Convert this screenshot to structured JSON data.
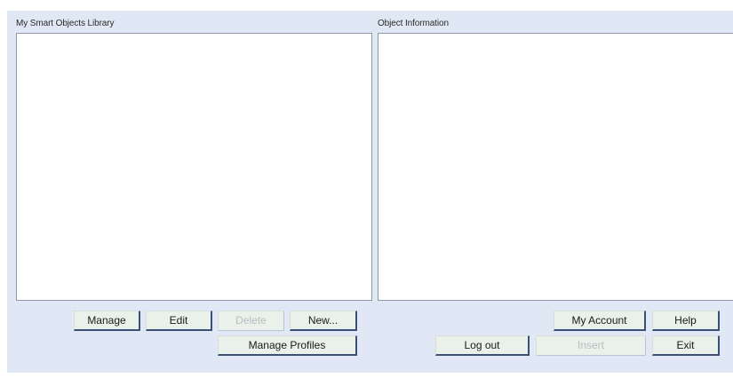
{
  "library_panel": {
    "title": "My Smart Objects Library"
  },
  "info_panel": {
    "title": "Object Information"
  },
  "buttons": {
    "manage": "Manage",
    "edit": "Edit",
    "delete": "Delete",
    "new": "New...",
    "manage_profiles": "Manage Profiles",
    "my_account": "My Account",
    "help": "Help",
    "log_out": "Log out",
    "insert": "Insert",
    "exit": "Exit"
  },
  "button_states": {
    "delete": "disabled",
    "insert": "disabled"
  }
}
